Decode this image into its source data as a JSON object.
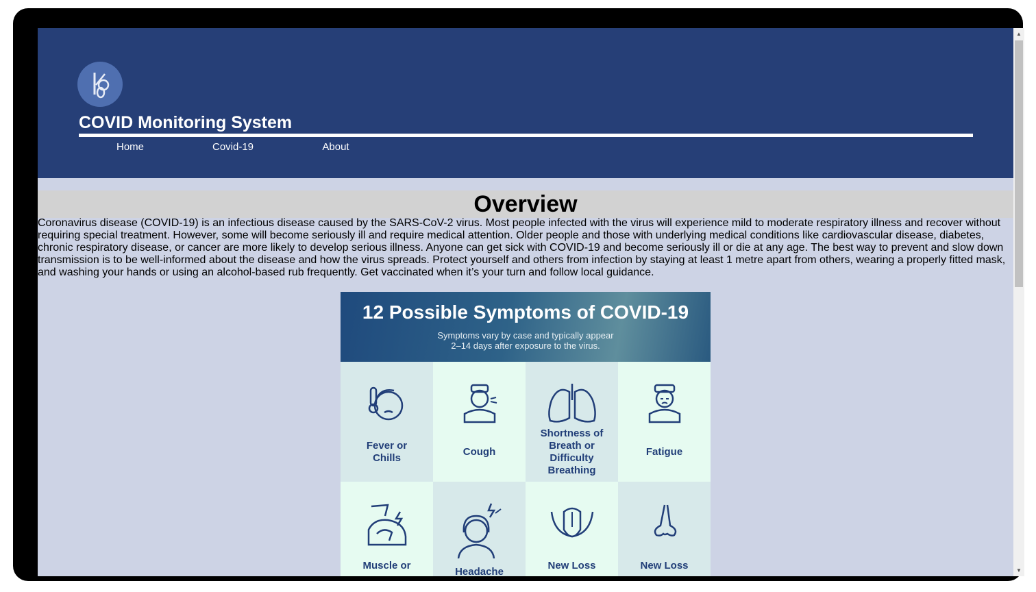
{
  "header": {
    "site_title": "COVID Monitoring System",
    "nav": [
      "Home",
      "Covid-19",
      "About"
    ]
  },
  "overview": {
    "title": "Overview",
    "text": "Coronavirus disease (COVID-19) is an infectious disease caused by the SARS-CoV-2 virus. Most people infected with the virus will experience mild to moderate respiratory illness and recover without requiring special treatment. However, some will become seriously ill and require medical attention. Older people and those with underlying medical conditions like cardiovascular disease, diabetes, chronic respiratory disease, or cancer are more likely to develop serious illness. Anyone can get sick with COVID-19 and become seriously ill or die at any age. The best way to prevent and slow down transmission is to be well-informed about the disease and how the virus spreads. Protect yourself and others from infection by staying at least 1 metre apart from others, wearing a properly fitted mask, and washing your hands or using an alcohol-based rub frequently. Get vaccinated when it’s your turn and follow local guidance."
  },
  "infographic": {
    "title": "12 Possible Symptoms of COVID-19",
    "subtitle_line1": "Symptoms vary by case and typically appear",
    "subtitle_line2": "2–14 days after exposure to the virus.",
    "symptoms": [
      {
        "label": "Fever or\nChills",
        "icon": "fever-icon"
      },
      {
        "label": "Cough",
        "icon": "cough-icon"
      },
      {
        "label": "Shortness of\nBreath or\nDifficulty\nBreathing",
        "icon": "lungs-icon"
      },
      {
        "label": "Fatigue",
        "icon": "fatigue-icon"
      },
      {
        "label": "Muscle or",
        "icon": "muscle-ache-icon"
      },
      {
        "label": "Headache",
        "icon": "headache-icon"
      },
      {
        "label": "New Loss",
        "icon": "tongue-icon"
      },
      {
        "label": "New Loss",
        "icon": "nose-icon"
      }
    ]
  },
  "colors": {
    "header_bg": "#263f77",
    "page_bg": "#cdd3e5",
    "icon_color": "#213e78"
  }
}
